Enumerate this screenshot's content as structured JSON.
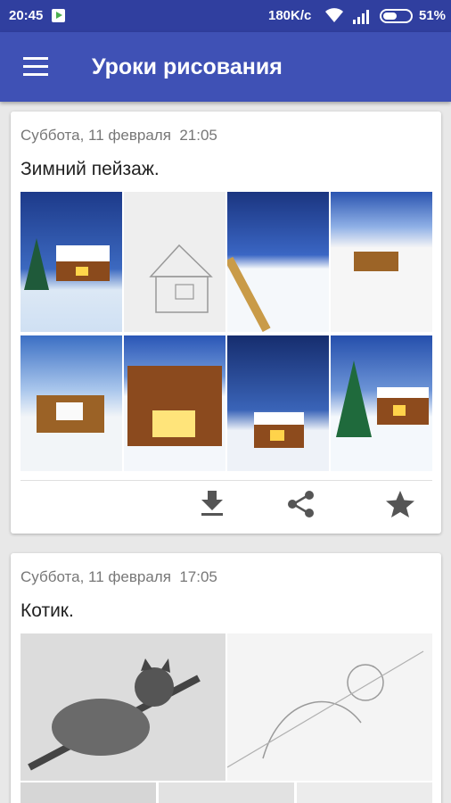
{
  "status_bar": {
    "time": "20:45",
    "speed": "180K/c",
    "battery": "51%",
    "battery_level": 0.51,
    "icons": [
      "play-store-icon",
      "wifi-icon",
      "signal-icon",
      "battery-icon"
    ]
  },
  "app_bar": {
    "title": "Уроки рисования",
    "menu_icon": "hamburger-menu-icon"
  },
  "posts": [
    {
      "date": "Суббота, 11 февраля  21:05",
      "caption": "Зимний пейзаж.",
      "images": [
        "winter-cabin-finished",
        "cabin-sketch",
        "snow-brush",
        "log-wall-start",
        "cabin-logs",
        "cabin-roof-close",
        "cabin-night-forest",
        "cabin-fir-tree"
      ],
      "actions": [
        "download-icon",
        "share-icon",
        "star-icon"
      ]
    },
    {
      "date": "Суббота, 11 февраля  17:05",
      "caption": "Котик.",
      "images": [
        "cat-pencil-drawing",
        "cat-sketch-outline"
      ]
    }
  ],
  "colors": {
    "status_bar": "#303f9f",
    "app_bar": "#3f51b5",
    "icon_gray": "#555555",
    "background": "#e8e8e8"
  }
}
